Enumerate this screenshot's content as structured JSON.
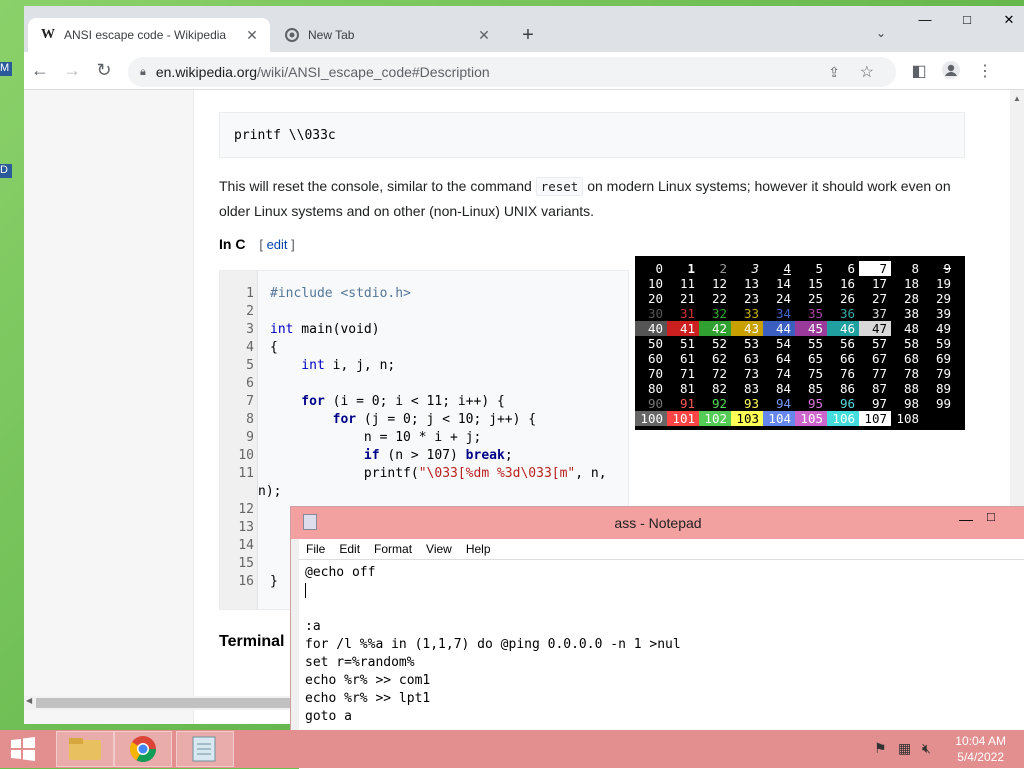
{
  "desktop": {
    "icon_letters": [
      "M",
      "D"
    ]
  },
  "chrome": {
    "tabs": [
      {
        "title": "ANSI escape code - Wikipedia",
        "favicon": "W"
      },
      {
        "title": "New Tab"
      }
    ],
    "new_tab_glyph": "+",
    "window_buttons": {
      "min": "—",
      "max": "□",
      "close": "✕"
    },
    "url_host": "en.wikipedia.org",
    "url_path": "/wiki/ANSI_escape_code#Description"
  },
  "article": {
    "code1": "printf \\\\033c",
    "para_before": "This will reset the console, similar to the command ",
    "para_code": "reset",
    "para_after": " on modern Linux systems; however it should work even on older Linux systems and on other (non-Linux) UNIX variants.",
    "heading": "In C",
    "edit_open": "[ ",
    "edit_link": "edit",
    "edit_close": " ]",
    "terminal_heading": "Terminal"
  },
  "code_lines": [
    {
      "n": "1"
    },
    {
      "n": "2"
    },
    {
      "n": "3"
    },
    {
      "n": "4"
    },
    {
      "n": "5"
    },
    {
      "n": "6"
    },
    {
      "n": "7"
    },
    {
      "n": "8"
    },
    {
      "n": "9"
    },
    {
      "n": "10"
    },
    {
      "n": "11"
    },
    {
      "n": "12"
    },
    {
      "n": "13"
    },
    {
      "n": "14"
    },
    {
      "n": "15"
    },
    {
      "n": "16"
    }
  ],
  "code": {
    "l1": "#include <stdio.h>",
    "l3_kw": "int",
    "l3_rest": " main(void)",
    "l4": "{",
    "l5_kw": "    int",
    "l5_rest": " i, j, n;",
    "l7_kw": "    for",
    "l7_rest": " (i = 0; i < 11; i++) {",
    "l8_kw": "        for",
    "l8_rest": " (j = 0; j < 10; j++) {",
    "l9": "            n = 10 * i + j;",
    "l10_kw": "            if",
    "l10_rest": " (n > 107) ",
    "l10_kw2": "break",
    "l10_end": ";",
    "l11_a": "            printf(",
    "l11_str": "\"\\033[%dm %3d\\033[m\"",
    "l11_b": ", n,",
    "l11_wrap": "n);",
    "l16": "}"
  },
  "ansi_table": {
    "rows": [
      [
        "0",
        "1",
        "2",
        "3",
        "4",
        "5",
        "6",
        "7",
        "8",
        "9"
      ],
      [
        "10",
        "11",
        "12",
        "13",
        "14",
        "15",
        "16",
        "17",
        "18",
        "19"
      ],
      [
        "20",
        "21",
        "22",
        "23",
        "24",
        "25",
        "26",
        "27",
        "28",
        "29"
      ],
      [
        "30",
        "31",
        "32",
        "33",
        "34",
        "35",
        "36",
        "37",
        "38",
        "39"
      ],
      [
        "40",
        "41",
        "42",
        "43",
        "44",
        "45",
        "46",
        "47",
        "48",
        "49"
      ],
      [
        "50",
        "51",
        "52",
        "53",
        "54",
        "55",
        "56",
        "57",
        "58",
        "59"
      ],
      [
        "60",
        "61",
        "62",
        "63",
        "64",
        "65",
        "66",
        "67",
        "68",
        "69"
      ],
      [
        "70",
        "71",
        "72",
        "73",
        "74",
        "75",
        "76",
        "77",
        "78",
        "79"
      ],
      [
        "80",
        "81",
        "82",
        "83",
        "84",
        "85",
        "86",
        "87",
        "88",
        "89"
      ],
      [
        "90",
        "91",
        "92",
        "93",
        "94",
        "95",
        "96",
        "97",
        "98",
        "99"
      ],
      [
        "100",
        "101",
        "102",
        "103",
        "104",
        "105",
        "106",
        "107",
        "108",
        ""
      ]
    ],
    "fg_colors": {
      "30": "#555555",
      "31": "#cc3333",
      "32": "#33aa33",
      "33": "#c8b000",
      "34": "#4466cc",
      "35": "#aa44aa",
      "36": "#33aaaa",
      "37": "#dddddd",
      "90": "#777777",
      "91": "#ff5555",
      "92": "#55dd55",
      "93": "#ffff55",
      "94": "#7799ff",
      "95": "#dd77dd",
      "96": "#55dddd",
      "97": "#ffffff"
    },
    "bg_colors": {
      "40": "#555555",
      "41": "#cc2020",
      "42": "#30a030",
      "43": "#c8a000",
      "44": "#3a5fc0",
      "45": "#9a3a9a",
      "46": "#20a0a0",
      "47": "#d8d8d8",
      "100": "#666666",
      "101": "#ff4444",
      "102": "#55cc55",
      "103": "#ffff55",
      "104": "#6688ee",
      "105": "#cc66cc",
      "106": "#44dddd",
      "107": "#ffffff"
    }
  },
  "notepad": {
    "title": "ass - Notepad",
    "menu": [
      "File",
      "Edit",
      "Format",
      "View",
      "Help"
    ],
    "lines": [
      "@echo off",
      "",
      "",
      ":a",
      "for /l %%a in (1,1,7) do @ping 0.0.0.0 -n 1 >nul",
      "set r=%random%",
      "echo %r% >> com1",
      "echo %r% >> lpt1",
      "goto a"
    ]
  },
  "taskbar": {
    "time": "10:04 AM",
    "date": "5/4/2022"
  }
}
